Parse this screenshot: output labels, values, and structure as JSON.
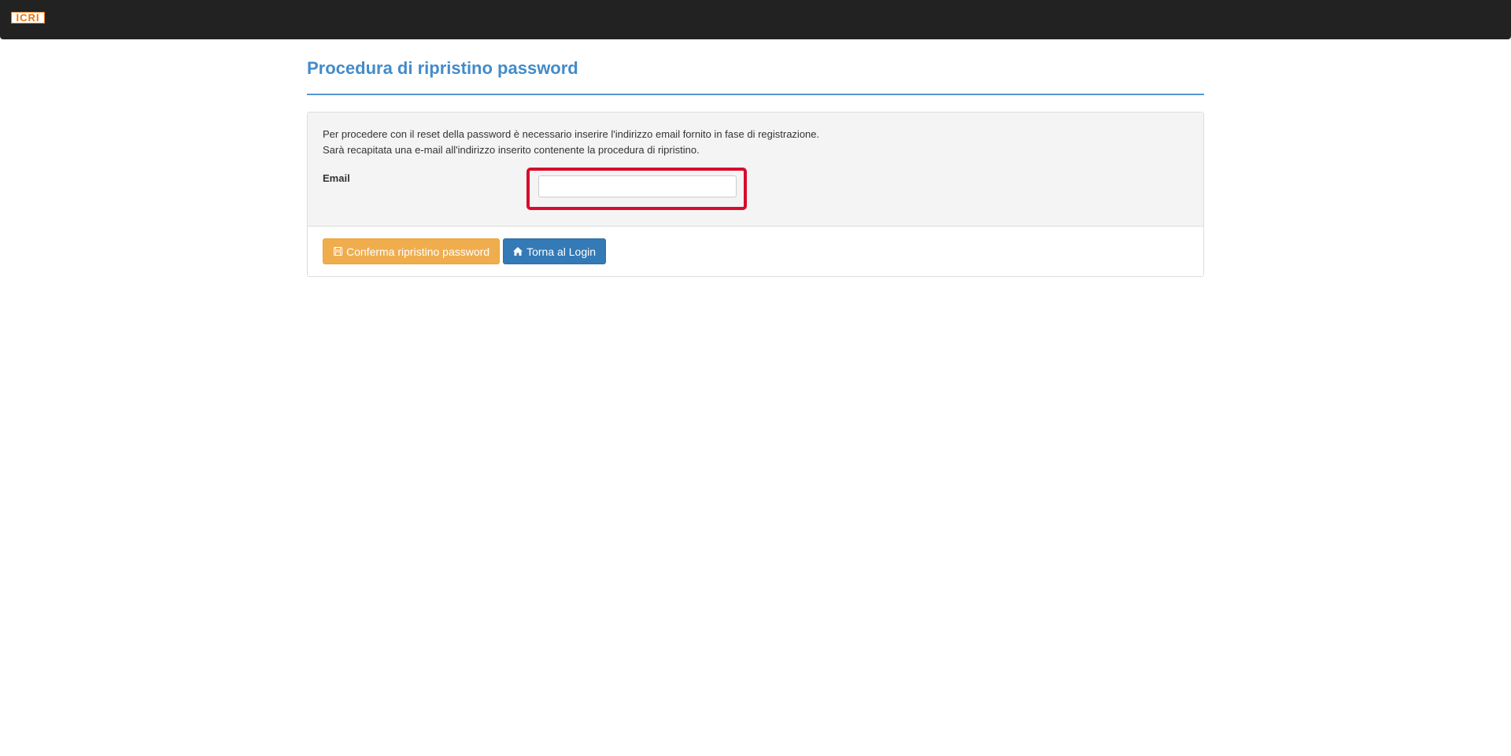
{
  "header": {
    "logo_text": "ICRI",
    "logo_color": "#e8750f",
    "background": "#222222"
  },
  "page": {
    "title": "Procedura di ripristino password",
    "accent_color": "#428bca"
  },
  "form": {
    "intro_line1": "Per procedere con il reset della password è necessario inserire l'indirizzo email fornito in fase di registrazione.",
    "intro_line2": "Sarà recapitata una e-mail all'indirizzo inserito contenente la procedura di ripristino.",
    "email_label": "Email",
    "email_value": "",
    "email_placeholder": "",
    "highlight_color": "#d70c2c"
  },
  "actions": {
    "confirm_label": "Conferma ripristino password",
    "confirm_icon": "floppy-disk-icon",
    "confirm_color": "#f0ad4e",
    "back_label": "Torna al Login",
    "back_icon": "home-icon",
    "back_color": "#337ab7"
  }
}
